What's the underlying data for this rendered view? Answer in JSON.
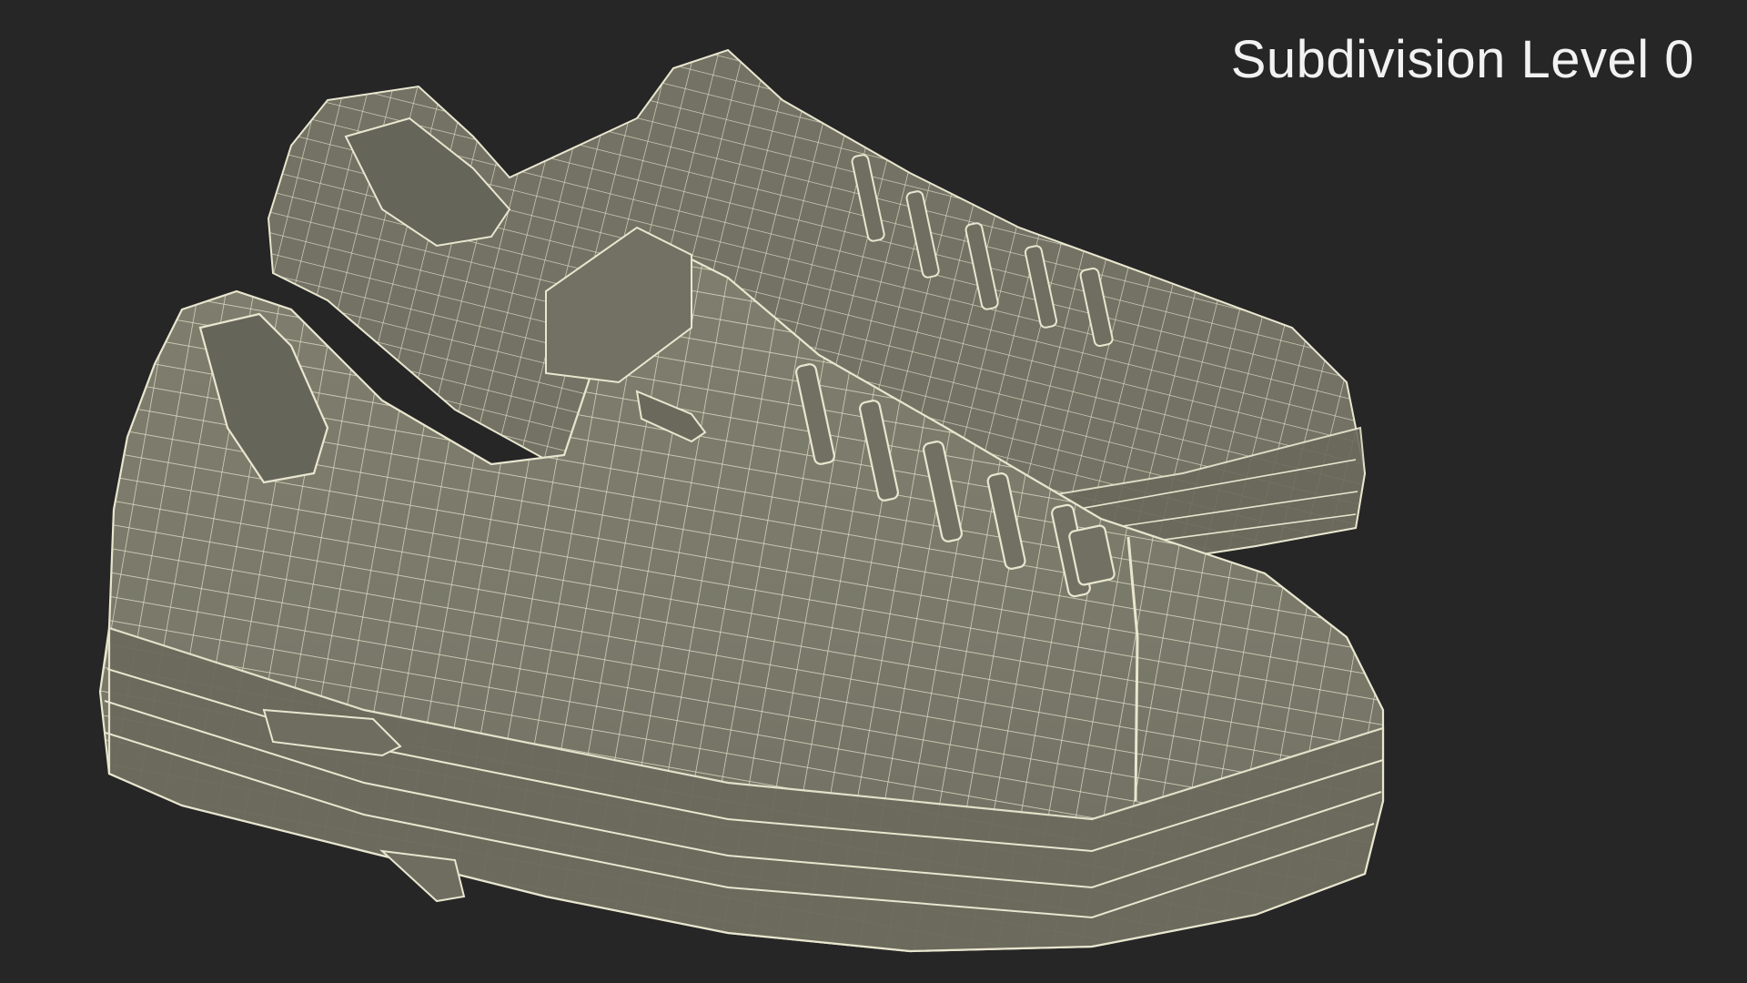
{
  "viewport": {
    "label": "Subdivision Level 0",
    "background_color": "#262626"
  },
  "model": {
    "description_icon": "sneaker-pair-wireframe",
    "surface_color": "#7b7a6a",
    "surface_shadow_color": "#5f5e52",
    "wire_color": "#e9e6cf"
  }
}
